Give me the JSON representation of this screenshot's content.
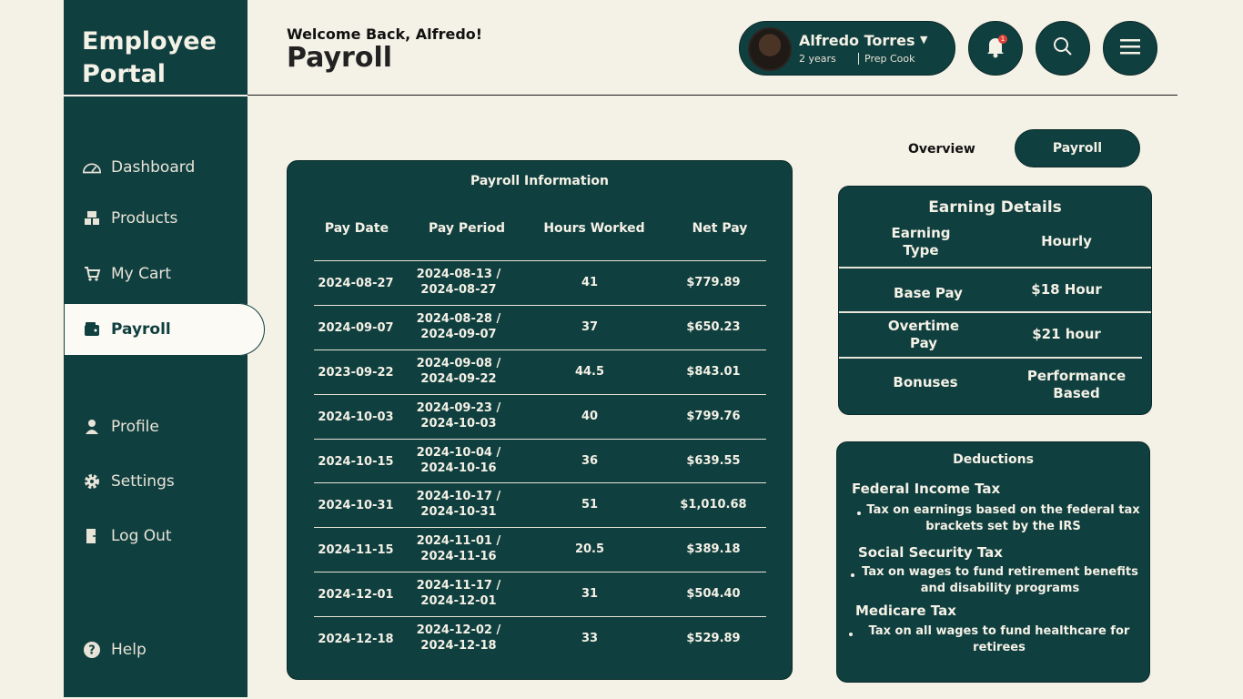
{
  "brand": {
    "line1": "Employee",
    "line2": "Portal"
  },
  "nav": [
    {
      "label": "Dashboard",
      "icon": "speedometer-icon"
    },
    {
      "label": "Products",
      "icon": "products-icon"
    },
    {
      "label": "My Cart",
      "icon": "cart-icon"
    },
    {
      "label": "Payroll",
      "icon": "wallet-icon",
      "active": true
    },
    {
      "label": "Profile",
      "icon": "person-icon"
    },
    {
      "label": "Settings",
      "icon": "gear-icon"
    },
    {
      "label": "Log Out",
      "icon": "logout-icon"
    },
    {
      "label": "Help",
      "icon": "help-icon"
    }
  ],
  "header": {
    "welcome": "Welcome Back, Alfredo!",
    "title": "Payroll"
  },
  "user": {
    "name": "Alfredo Torres",
    "years": "2 years",
    "role": "Prep Cook",
    "notifications": "1"
  },
  "tabs": {
    "overview": "Overview",
    "payroll": "Payroll"
  },
  "payroll_table": {
    "title": "Payroll Information",
    "headers": [
      "Pay Date",
      "Pay Period",
      "Hours Worked",
      "Net Pay"
    ],
    "rows": [
      {
        "date": "2024-08-27",
        "period1": "2024-08-13 /",
        "period2": "2024-08-27",
        "hours": "41",
        "net": "$779.89"
      },
      {
        "date": "2024-09-07",
        "period1": "2024-08-28 /",
        "period2": "2024-09-07",
        "hours": "37",
        "net": "$650.23"
      },
      {
        "date": "2023-09-22",
        "period1": "2024-09-08 /",
        "period2": "2024-09-22",
        "hours": "44.5",
        "net": "$843.01"
      },
      {
        "date": "2024-10-03",
        "period1": "2024-09-23 /",
        "period2": "2024-10-03",
        "hours": "40",
        "net": "$799.76"
      },
      {
        "date": "2024-10-15",
        "period1": "2024-10-04 /",
        "period2": "2024-10-16",
        "hours": "36",
        "net": "$639.55"
      },
      {
        "date": "2024-10-31",
        "period1": "2024-10-17 /",
        "period2": "2024-10-31",
        "hours": "51",
        "net": "$1,010.68"
      },
      {
        "date": "2024-11-15",
        "period1": "2024-11-01 /",
        "period2": "2024-11-16",
        "hours": "20.5",
        "net": "$389.18"
      },
      {
        "date": "2024-12-01",
        "period1": "2024-11-17 /",
        "period2": "2024-12-01",
        "hours": "31",
        "net": "$504.40"
      },
      {
        "date": "2024-12-18",
        "period1": "2024-12-02 /",
        "period2": "2024-12-18",
        "hours": "33",
        "net": "$529.89"
      }
    ]
  },
  "earnings": {
    "title": "Earning Details",
    "header_type_1": "Earning",
    "header_type_2": "Type",
    "header_rate": "Hourly",
    "base_label": "Base Pay",
    "base_value": "$18 Hour",
    "overtime_label_1": "Overtime",
    "overtime_label_2": "Pay",
    "overtime_value": "$21 hour",
    "bonus_label": "Bonuses",
    "bonus_value_1": "Performance",
    "bonus_value_2": "Based"
  },
  "deductions": {
    "title": "Deductions",
    "federal_title": "Federal Income Tax",
    "federal_line1": "Tax on earnings based on the federal tax",
    "federal_line2": "brackets set by the IRS",
    "ss_title": "Social Security Tax",
    "ss_line1": "Tax on wages to fund retirement benefits",
    "ss_line2": "and disability programs",
    "medicare_title": "Medicare Tax",
    "medicare_line1": "Tax on all wages to fund healthcare for",
    "medicare_line2": "retirees"
  },
  "colors": {
    "primary": "#103f3f",
    "background": "#f4f1e6",
    "text_light": "#f4f1e6",
    "badge": "#e0413a"
  }
}
